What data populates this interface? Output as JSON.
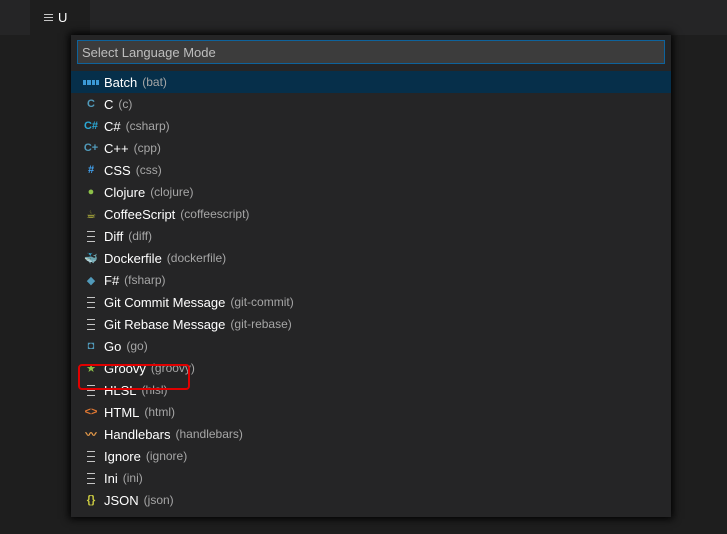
{
  "editor": {
    "tab_title": "U"
  },
  "quick_pick": {
    "placeholder": "Select Language Mode",
    "items": [
      {
        "label": "Batch",
        "id": "(bat)",
        "icon": "windows-icon",
        "glyph": "",
        "color": "#3c9ad6"
      },
      {
        "label": "C",
        "id": "(c)",
        "icon": "c-icon",
        "glyph": "C",
        "color": "#519aba"
      },
      {
        "label": "C#",
        "id": "(csharp)",
        "icon": "csharp-icon",
        "glyph": "C#",
        "color": "#2ba9d6"
      },
      {
        "label": "C++",
        "id": "(cpp)",
        "icon": "cpp-icon",
        "glyph": "C+",
        "color": "#519aba"
      },
      {
        "label": "CSS",
        "id": "(css)",
        "icon": "hash-icon",
        "glyph": "#",
        "color": "#42a5f5"
      },
      {
        "label": "Clojure",
        "id": "(clojure)",
        "icon": "clojure-icon",
        "glyph": "●",
        "color": "#8dc149"
      },
      {
        "label": "CoffeeScript",
        "id": "(coffeescript)",
        "icon": "coffee-icon",
        "glyph": "☕",
        "color": "#cbcb41"
      },
      {
        "label": "Diff",
        "id": "(diff)",
        "icon": "lines-icon",
        "glyph": "",
        "color": "#c5c5c5"
      },
      {
        "label": "Dockerfile",
        "id": "(dockerfile)",
        "icon": "docker-icon",
        "glyph": "🐳",
        "color": "#2aa2d3"
      },
      {
        "label": "F#",
        "id": "(fsharp)",
        "icon": "fsharp-icon",
        "glyph": "◆",
        "color": "#519aba"
      },
      {
        "label": "Git Commit Message",
        "id": "(git-commit)",
        "icon": "lines-icon",
        "glyph": "",
        "color": "#c5c5c5"
      },
      {
        "label": "Git Rebase Message",
        "id": "(git-rebase)",
        "icon": "lines-icon",
        "glyph": "",
        "color": "#c5c5c5"
      },
      {
        "label": "Go",
        "id": "(go)",
        "icon": "go-icon",
        "glyph": "◘",
        "color": "#519aba"
      },
      {
        "label": "Groovy",
        "id": "(groovy)",
        "icon": "groovy-icon",
        "glyph": "★",
        "color": "#8dc149"
      },
      {
        "label": "HLSL",
        "id": "(hlsl)",
        "icon": "lines-icon",
        "glyph": "",
        "color": "#c5c5c5"
      },
      {
        "label": "HTML",
        "id": "(html)",
        "icon": "html-icon",
        "glyph": "<>",
        "color": "#e37933"
      },
      {
        "label": "Handlebars",
        "id": "(handlebars)",
        "icon": "handlebars-icon",
        "glyph": "〰",
        "color": "#f0a04b"
      },
      {
        "label": "Ignore",
        "id": "(ignore)",
        "icon": "lines-icon",
        "glyph": "",
        "color": "#c5c5c5"
      },
      {
        "label": "Ini",
        "id": "(ini)",
        "icon": "lines-icon",
        "glyph": "",
        "color": "#c5c5c5"
      },
      {
        "label": "JSON",
        "id": "(json)",
        "icon": "json-icon",
        "glyph": "{}",
        "color": "#cbcb41"
      }
    ],
    "selected_index": 0,
    "highlighted_item": "HTML"
  },
  "colors": {
    "selection_bg": "#062f4a",
    "input_border": "#0e639c",
    "highlight_border": "#e00000"
  }
}
